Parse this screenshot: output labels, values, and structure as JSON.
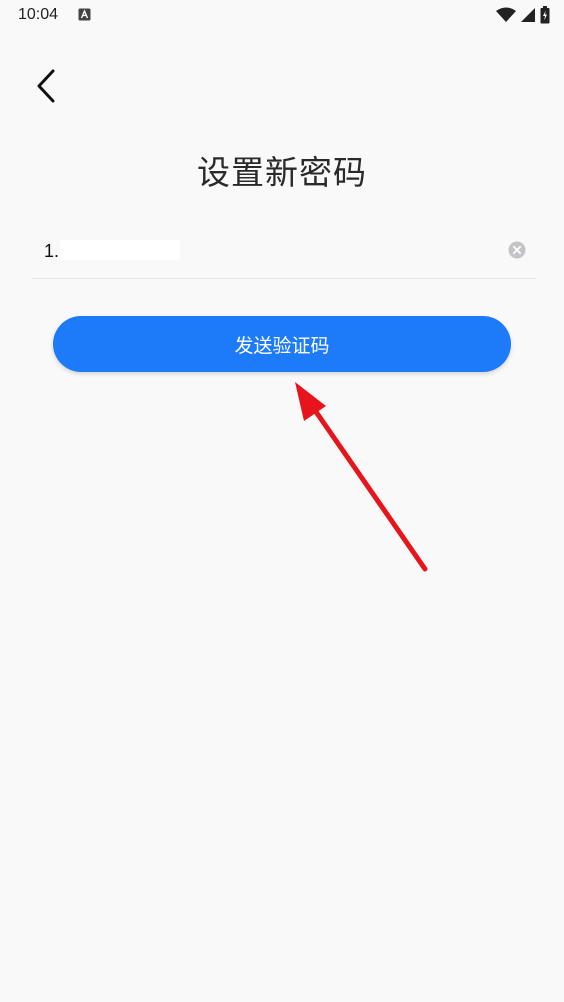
{
  "status_bar": {
    "time": "10:04",
    "icons": [
      "notification-a-icon",
      "wifi-icon",
      "signal-icon",
      "battery-charging-icon"
    ]
  },
  "header": {
    "back_icon": "chevron-left-icon"
  },
  "page_title": "设置新密码",
  "phone_field": {
    "value": "1.",
    "clear_icon": "clear-circle-icon"
  },
  "send_code_button": {
    "label": "发送验证码"
  },
  "colors": {
    "background": "#f9f9fa",
    "primary_button": "#1d7bfa",
    "arrow": "#e8141b"
  }
}
